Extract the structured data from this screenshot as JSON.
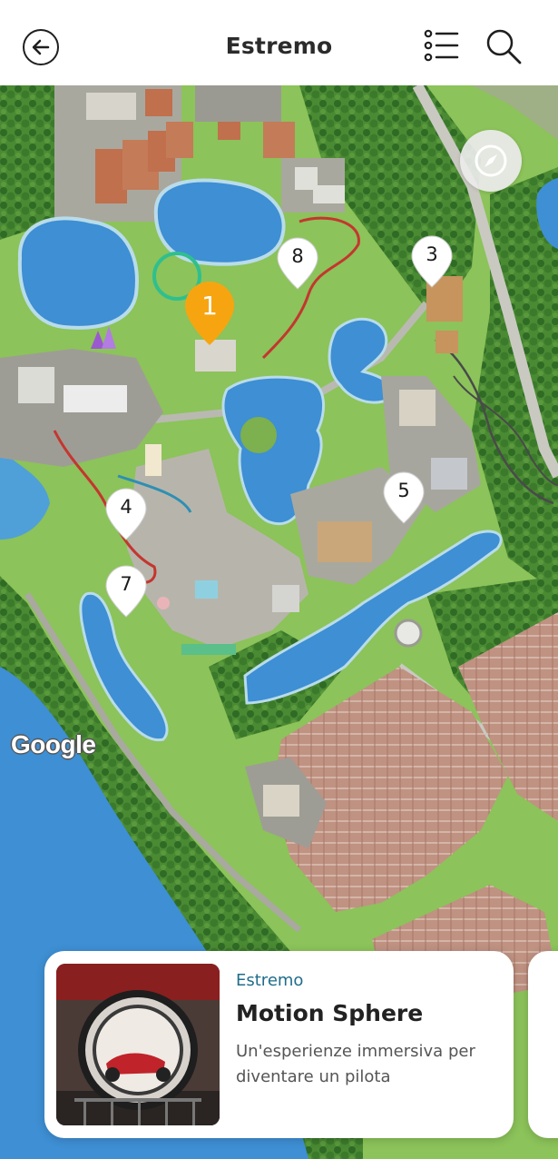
{
  "header": {
    "title": "Estremo",
    "back_icon": "arrow-left-icon",
    "list_icon": "list-icon",
    "search_icon": "search-icon"
  },
  "map": {
    "compass_icon": "compass-icon",
    "attribution": "Google",
    "pins": [
      {
        "label": "1",
        "active": true
      },
      {
        "label": "8",
        "active": false
      },
      {
        "label": "3",
        "active": false
      },
      {
        "label": "4",
        "active": false
      },
      {
        "label": "5",
        "active": false
      },
      {
        "label": "7",
        "active": false
      }
    ],
    "colors": {
      "active_pin": "#f6a511",
      "inactive_pin": "#ffffff",
      "water": "#3e8fd4",
      "grass": "#8cc35a",
      "trees": "#3f7a2c",
      "parking": "#b88a78"
    }
  },
  "card": {
    "category": "Estremo",
    "title": "Motion Sphere",
    "description": "Un'esperienze immersiva per diventare un pilota"
  }
}
